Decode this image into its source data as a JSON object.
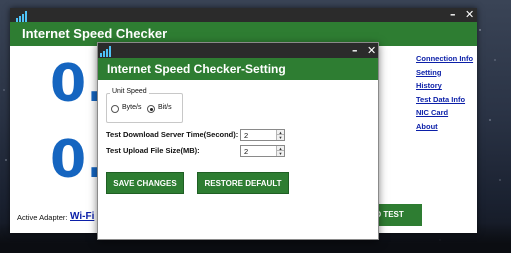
{
  "main_window": {
    "title": "Internet Speed Checker",
    "digits": [
      "0.",
      "0."
    ],
    "side_links": [
      "Connection Info",
      "Setting",
      "History",
      "Test Data Info",
      "NIC Card",
      "About"
    ],
    "active_adapter_label": "Active Adapter:",
    "adapter_value": "Wi-Fi",
    "speed_test_button": "ED TEST",
    "window_controls": {
      "minimize": "–",
      "close": "✕"
    }
  },
  "settings_dialog": {
    "title": "Internet Speed Checker-Setting",
    "unit_speed_group": {
      "legend": "Unit Speed",
      "options": [
        "Byte/s",
        "Bit/s"
      ],
      "selected": "Bit/s"
    },
    "download_time_label": "Test Download Server Time(Second):",
    "download_time_value": "2",
    "upload_size_label": "Test Upload File Size(MB):",
    "upload_size_value": "2",
    "save_button": "SAVE CHANGES",
    "restore_button": "RESTORE DEFAULT",
    "window_controls": {
      "minimize": "–",
      "close": "✕"
    }
  },
  "colors": {
    "accent_green": "#2e7d32",
    "digit_blue": "#1565c0",
    "link_blue": "#0b1fa8",
    "titlebar_dark": "#2b2b2b"
  },
  "icons": {
    "app": "signal-bars-icon",
    "spin_up": "triangle-up-icon",
    "spin_down": "triangle-down-icon"
  }
}
